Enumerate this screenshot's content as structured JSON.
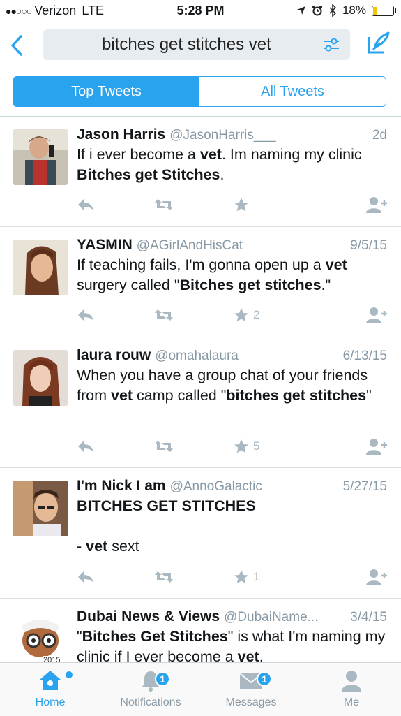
{
  "status": {
    "carrier": "Verizon",
    "network": "LTE",
    "time": "5:28 PM",
    "battery": "18%"
  },
  "search": {
    "query": "bitches get stitches vet"
  },
  "segments": {
    "top": "Top Tweets",
    "all": "All Tweets"
  },
  "tweets": [
    {
      "name": "Jason Harris",
      "handle": "@JasonHarris___",
      "date": "2d",
      "parts": [
        "If i ever become a ",
        "vet",
        ". Im naming my clinic ",
        "Bitches get Stitches",
        "."
      ],
      "likes": ""
    },
    {
      "name": "YASMIN",
      "handle": "@AGirlAndHisCat",
      "date": "9/5/15",
      "parts": [
        "If teaching fails, I'm gonna open up a ",
        "vet",
        " surgery called \"",
        "Bitches get stitches",
        ".\""
      ],
      "likes": "2"
    },
    {
      "name": "laura rouw",
      "handle": "@omahalaura",
      "date": "6/13/15",
      "parts": [
        "When you have a group chat of your friends from ",
        "vet",
        " camp called \"",
        "bitches get stitches",
        "\""
      ],
      "likes": "5"
    },
    {
      "name": "I'm Nick I am",
      "handle": "@AnnoGalactic",
      "date": "5/27/15",
      "line1": "BITCHES GET STITCHES",
      "line2a": "- ",
      "line2b": "vet",
      "line2c": " sext",
      "likes": "1"
    },
    {
      "name": "Dubai News & Views",
      "handle": "@DubaiName...",
      "date": "3/4/15",
      "parts": [
        "\"",
        "Bitches Get Stitches",
        "\" is what I'm naming my clinic if I ever become a ",
        "vet",
        "."
      ],
      "likes": "",
      "avatar_text": "2015"
    }
  ],
  "tabs": {
    "home": "Home",
    "notifications": "Notifications",
    "notifications_badge": "1",
    "messages": "Messages",
    "messages_badge": "1",
    "me": "Me"
  },
  "colors": {
    "accent": "#2aa3ef",
    "muted": "#8899a6",
    "icon": "#aab8c2"
  }
}
